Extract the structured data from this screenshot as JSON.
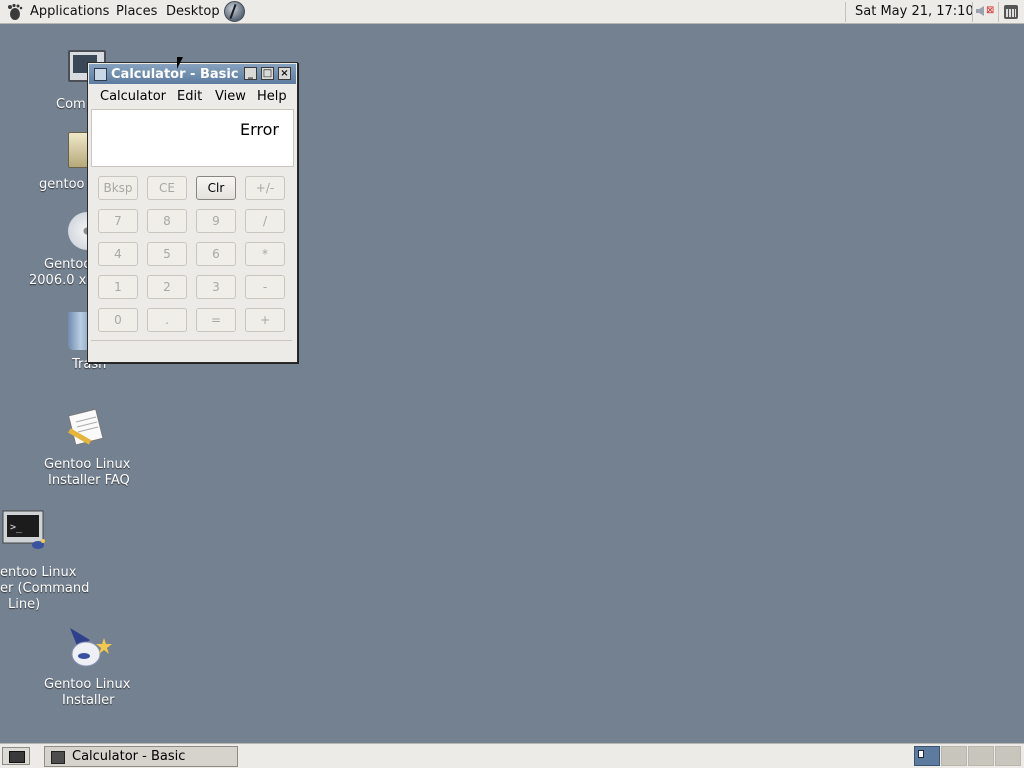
{
  "top_panel": {
    "menus": [
      "Applications",
      "Places",
      "Desktop"
    ],
    "clock": "Sat May 21, 17:10"
  },
  "desktop_icons": {
    "computer": {
      "label": "Comp"
    },
    "home": {
      "label": "gentoo"
    },
    "cd": {
      "line1": "Gentoo",
      "line2": "2006.0 x"
    },
    "trash": {
      "label": "Trash"
    },
    "faq": {
      "line1": "Gentoo Linux",
      "line2": "Installer FAQ"
    },
    "installer_cl": {
      "line1": "entoo Linux",
      "line2": "er (Command",
      "line3": "Line)"
    },
    "installer": {
      "line1": "Gentoo Linux",
      "line2": "Installer"
    }
  },
  "window": {
    "title": "Calculator  - Basic",
    "menus": [
      {
        "label": "Calculator",
        "accel": "C",
        "rest": "alculator"
      },
      {
        "label": "Edit",
        "accel": "E",
        "rest": "dit"
      },
      {
        "label": "View",
        "accel": "V",
        "rest": "iew"
      },
      {
        "label": "Help",
        "accel": "H",
        "rest": "elp"
      }
    ],
    "display": "Error",
    "keys": [
      [
        "Bksp",
        "CE",
        "Clr",
        "+/-"
      ],
      [
        "7",
        "8",
        "9",
        "/"
      ],
      [
        "4",
        "5",
        "6",
        "*"
      ],
      [
        "1",
        "2",
        "3",
        "-"
      ],
      [
        "0",
        ".",
        "=",
        "+"
      ]
    ],
    "enabled_keys": [
      "Clr"
    ]
  },
  "taskbar": {
    "task_label": "Calculator  - Basic",
    "workspaces": 4,
    "active_workspace": 1
  },
  "colors": {
    "desktop": "#738191",
    "title_bar": "#5c7b9f",
    "panel": "#ecebe7"
  }
}
